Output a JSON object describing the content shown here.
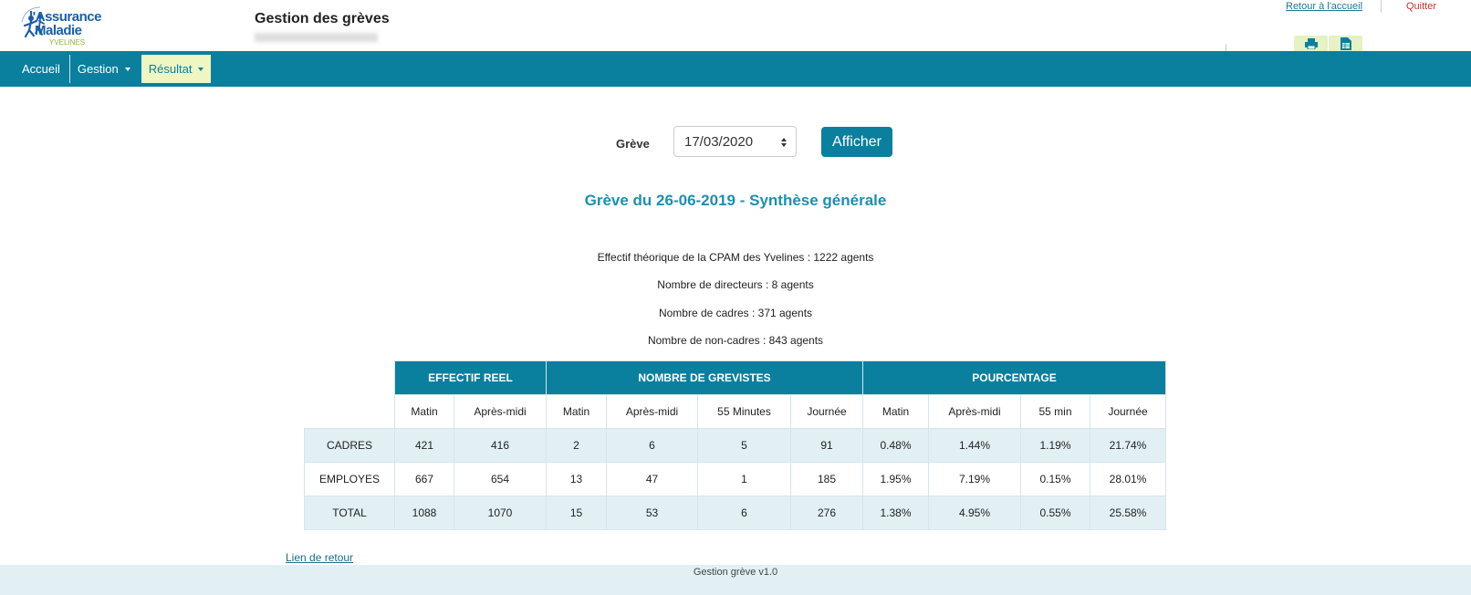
{
  "header": {
    "logo_line1": "l'Assurance",
    "logo_line2": "Maladie",
    "logo_line3": "YVELINES",
    "app_title": "Gestion des grèves",
    "back_home_link": "Retour à l'accueil",
    "quit_link": "Quitter",
    "tools": [
      {
        "icon": "printer-icon"
      },
      {
        "icon": "excel-icon"
      }
    ]
  },
  "navbar": {
    "items": [
      {
        "label": "Accueil",
        "dropdown": false
      },
      {
        "label": "Gestion",
        "dropdown": true
      },
      {
        "label": "Résultat",
        "dropdown": true,
        "active": true
      }
    ]
  },
  "filter": {
    "label": "Grève",
    "selected_value": "17/03/2020",
    "button_label": "Afficher"
  },
  "summary": {
    "title": "Grève du 26-06-2019 - Synthèse générale",
    "lines": [
      "Effectif théorique de la CPAM des Yvelines : 1222 agents",
      "Nombre de directeurs : 8 agents",
      "Nombre de cadres : 371 agents",
      "Nombre de non-cadres : 843 agents"
    ]
  },
  "table": {
    "groups": [
      "EFFECTIF REEL",
      "NOMBRE DE GREVISTES",
      "POURCENTAGE"
    ],
    "subheaders": [
      "Matin",
      "Après-midi",
      "Matin",
      "Après-midi",
      "55 Minutes",
      "Journée",
      "Matin",
      "Après-midi",
      "55 min",
      "Journée"
    ],
    "rows": [
      {
        "label": "CADRES",
        "cells": [
          "421",
          "416",
          "2",
          "6",
          "5",
          "91",
          "0.48%",
          "1.44%",
          "1.19%",
          "21.74%"
        ]
      },
      {
        "label": "EMPLOYES",
        "cells": [
          "667",
          "654",
          "13",
          "47",
          "1",
          "185",
          "1.95%",
          "7.19%",
          "0.15%",
          "28.01%"
        ]
      },
      {
        "label": "TOTAL",
        "cells": [
          "1088",
          "1070",
          "15",
          "53",
          "6",
          "276",
          "1.38%",
          "4.95%",
          "0.55%",
          "25.58%"
        ]
      }
    ]
  },
  "back_link": "Lien de retour",
  "footer": "Gestion grève v1.0",
  "colors": {
    "primary": "#0a7f9e",
    "title": "#1d8fb0",
    "active_nav": "#eef6c4",
    "row_alt": "#e2f0f4",
    "quit": "#c0392b"
  }
}
